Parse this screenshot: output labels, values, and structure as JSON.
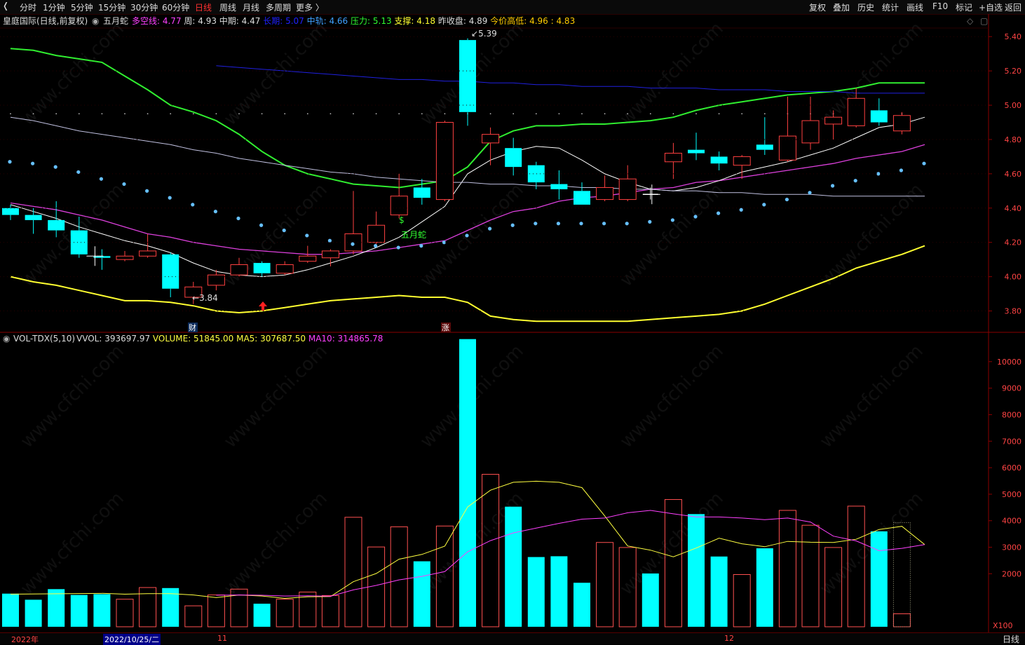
{
  "toolbar": {
    "collapse_icon": "chevron-left-icon",
    "periods": [
      {
        "label": "分时"
      },
      {
        "label": "1分钟"
      },
      {
        "label": "5分钟"
      },
      {
        "label": "15分钟"
      },
      {
        "label": "30分钟"
      },
      {
        "label": "60分钟"
      },
      {
        "label": "日线",
        "active": true
      },
      {
        "label": "周线"
      },
      {
        "label": "月线"
      },
      {
        "label": "多周期"
      },
      {
        "label": "更多 〉"
      }
    ],
    "right_buttons": [
      "复权",
      "叠加",
      "历史",
      "统计",
      "画线",
      "F10",
      "标记",
      "+自选",
      "返回"
    ]
  },
  "main_info": {
    "title": "皇庭国际(日线,前复权)",
    "indicator": "五月蛇",
    "items": [
      {
        "label": "多空线:",
        "value": "4.77",
        "color": "#ff40ff"
      },
      {
        "label": "周:",
        "value": "4.93",
        "color": "#dddddd"
      },
      {
        "label": "中期:",
        "value": "4.47",
        "color": "#dddddd"
      },
      {
        "label": "长期:",
        "value": "5.07",
        "color": "#2020ff"
      },
      {
        "label": "中轨:",
        "value": "4.66",
        "color": "#40a0ff"
      },
      {
        "label": "压力:",
        "value": "5.13",
        "color": "#30ff30"
      },
      {
        "label": "支撑:",
        "value": "4.18",
        "color": "#ffff30"
      },
      {
        "label": "昨收盘:",
        "value": "4.89",
        "color": "#dddddd"
      },
      {
        "label": "今价高低:",
        "value": "4.96 : 4.83",
        "color": "#ffcc00"
      }
    ]
  },
  "vol_info": {
    "name": "VOL-TDX(5,10)",
    "items": [
      {
        "label": "VVOL:",
        "value": "393697.97",
        "color": "#dddddd"
      },
      {
        "label": "VOLUME:",
        "value": "51845.00",
        "color": "#ffff40"
      },
      {
        "label": "MA5:",
        "value": "307687.50",
        "color": "#ffff40"
      },
      {
        "label": "MA10:",
        "value": "314865.78",
        "color": "#ff40ff"
      }
    ]
  },
  "annotations": {
    "high_label": "5.39",
    "low_label": "3.84",
    "signal_label": "五月蛇",
    "dollar_sign": "$",
    "event_cai": "财",
    "event_zhang": "涨",
    "vol_multiplier": "X100"
  },
  "bottom": {
    "dates": [
      {
        "label": "2022年"
      },
      {
        "label": "2022/10/25/二",
        "selected": true
      },
      {
        "label": "11"
      },
      {
        "label": "12"
      }
    ],
    "period_label": "日线"
  },
  "chart_data": [
    {
      "type": "candlestick",
      "ylim": [
        3.7,
        5.45
      ],
      "y_ticks": [
        3.8,
        4.0,
        4.2,
        4.4,
        4.6,
        4.8,
        5.0,
        5.2,
        5.4
      ],
      "candles": [
        {
          "o": 4.4,
          "c": 4.36,
          "h": 4.42,
          "l": 4.33
        },
        {
          "o": 4.36,
          "c": 4.33,
          "h": 4.4,
          "l": 4.25
        },
        {
          "o": 4.33,
          "c": 4.27,
          "h": 4.44,
          "l": 4.23
        },
        {
          "o": 4.27,
          "c": 4.13,
          "h": 4.35,
          "l": 4.11
        },
        {
          "o": 4.12,
          "c": 4.11,
          "h": 4.16,
          "l": 4.04
        },
        {
          "o": 4.1,
          "c": 4.12,
          "h": 4.15,
          "l": 4.09
        },
        {
          "o": 4.12,
          "c": 4.15,
          "h": 4.25,
          "l": 4.11
        },
        {
          "o": 4.13,
          "c": 3.93,
          "h": 4.14,
          "l": 3.88
        },
        {
          "o": 3.88,
          "c": 3.94,
          "h": 3.97,
          "l": 3.84
        },
        {
          "o": 3.95,
          "c": 4.01,
          "h": 4.04,
          "l": 3.92
        },
        {
          "o": 4.01,
          "c": 4.07,
          "h": 4.11,
          "l": 4.0
        },
        {
          "o": 4.08,
          "c": 4.02,
          "h": 4.09,
          "l": 4.0
        },
        {
          "o": 4.02,
          "c": 4.07,
          "h": 4.09,
          "l": 4.01
        },
        {
          "o": 4.09,
          "c": 4.12,
          "h": 4.18,
          "l": 4.08
        },
        {
          "o": 4.11,
          "c": 4.15,
          "h": 4.16,
          "l": 4.06
        },
        {
          "o": 4.15,
          "c": 4.25,
          "h": 4.5,
          "l": 4.13
        },
        {
          "o": 4.2,
          "c": 4.3,
          "h": 4.38,
          "l": 4.19
        },
        {
          "o": 4.36,
          "c": 4.47,
          "h": 4.6,
          "l": 4.34
        },
        {
          "o": 4.52,
          "c": 4.46,
          "h": 4.57,
          "l": 4.42
        },
        {
          "o": 4.45,
          "c": 4.9,
          "h": 4.91,
          "l": 4.44
        },
        {
          "o": 5.38,
          "c": 4.96,
          "h": 5.39,
          "l": 4.88
        },
        {
          "o": 4.78,
          "c": 4.83,
          "h": 4.87,
          "l": 4.65
        },
        {
          "o": 4.75,
          "c": 4.64,
          "h": 4.81,
          "l": 4.59
        },
        {
          "o": 4.65,
          "c": 4.55,
          "h": 4.67,
          "l": 4.51
        },
        {
          "o": 4.54,
          "c": 4.51,
          "h": 4.62,
          "l": 4.45
        },
        {
          "o": 4.5,
          "c": 4.42,
          "h": 4.55,
          "l": 4.42
        },
        {
          "o": 4.45,
          "c": 4.52,
          "h": 4.59,
          "l": 4.44
        },
        {
          "o": 4.45,
          "c": 4.57,
          "h": 4.65,
          "l": 4.44
        },
        {
          "o": 4.48,
          "c": 4.48,
          "h": 4.52,
          "l": 4.45
        },
        {
          "o": 4.67,
          "c": 4.72,
          "h": 4.78,
          "l": 4.57
        },
        {
          "o": 4.74,
          "c": 4.72,
          "h": 4.84,
          "l": 4.68
        },
        {
          "o": 4.7,
          "c": 4.66,
          "h": 4.73,
          "l": 4.62
        },
        {
          "o": 4.65,
          "c": 4.7,
          "h": 4.71,
          "l": 4.57
        },
        {
          "o": 4.77,
          "c": 4.74,
          "h": 4.93,
          "l": 4.71
        },
        {
          "o": 4.68,
          "c": 4.82,
          "h": 5.05,
          "l": 4.67
        },
        {
          "o": 4.78,
          "c": 4.91,
          "h": 5.05,
          "l": 4.74
        },
        {
          "o": 4.89,
          "c": 4.93,
          "h": 4.97,
          "l": 4.8
        },
        {
          "o": 4.88,
          "c": 5.04,
          "h": 5.1,
          "l": 4.87
        },
        {
          "o": 4.97,
          "c": 4.9,
          "h": 5.04,
          "l": 4.88
        },
        {
          "o": 4.85,
          "c": 4.94,
          "h": 4.96,
          "l": 4.83
        }
      ],
      "lines": {
        "压力": [
          5.33,
          5.32,
          5.29,
          5.27,
          5.25,
          5.17,
          5.09,
          5.0,
          4.96,
          4.91,
          4.83,
          4.73,
          4.65,
          4.6,
          4.57,
          4.54,
          4.53,
          4.52,
          4.54,
          4.56,
          4.64,
          4.79,
          4.85,
          4.88,
          4.88,
          4.89,
          4.89,
          4.9,
          4.91,
          4.93,
          4.97,
          5.0,
          5.02,
          5.04,
          5.06,
          5.07,
          5.08,
          5.1,
          5.13,
          5.13,
          5.13
        ],
        "支撑": [
          4.0,
          3.97,
          3.95,
          3.92,
          3.89,
          3.86,
          3.86,
          3.85,
          3.83,
          3.8,
          3.79,
          3.8,
          3.82,
          3.84,
          3.86,
          3.87,
          3.88,
          3.89,
          3.88,
          3.88,
          3.85,
          3.77,
          3.75,
          3.74,
          3.74,
          3.74,
          3.74,
          3.74,
          3.75,
          3.76,
          3.77,
          3.78,
          3.8,
          3.84,
          3.89,
          3.94,
          3.99,
          4.05,
          4.09,
          4.13,
          4.18
        ],
        "多空线": [
          4.43,
          4.41,
          4.39,
          4.36,
          4.33,
          4.29,
          4.25,
          4.23,
          4.2,
          4.18,
          4.16,
          4.15,
          4.14,
          4.13,
          4.13,
          4.14,
          4.15,
          4.17,
          4.19,
          4.21,
          4.27,
          4.33,
          4.38,
          4.4,
          4.44,
          4.46,
          4.47,
          4.49,
          4.51,
          4.52,
          4.55,
          4.56,
          4.58,
          4.6,
          4.62,
          4.64,
          4.66,
          4.69,
          4.71,
          4.73,
          4.77
        ],
        "周": [
          4.42,
          4.38,
          4.34,
          4.29,
          4.25,
          4.21,
          4.18,
          4.14,
          4.08,
          4.03,
          4.01,
          4.0,
          4.01,
          4.04,
          4.08,
          4.12,
          4.17,
          4.23,
          4.32,
          4.41,
          4.6,
          4.68,
          4.73,
          4.76,
          4.75,
          4.68,
          4.6,
          4.55,
          4.51,
          4.5,
          4.52,
          4.56,
          4.61,
          4.64,
          4.67,
          4.71,
          4.75,
          4.81,
          4.87,
          4.89,
          4.93
        ],
        "中期": [
          4.93,
          4.91,
          4.88,
          4.85,
          4.83,
          4.81,
          4.79,
          4.77,
          4.74,
          4.72,
          4.69,
          4.67,
          4.65,
          4.63,
          4.61,
          4.6,
          4.58,
          4.57,
          4.56,
          4.55,
          4.55,
          4.54,
          4.54,
          4.53,
          4.53,
          4.52,
          4.52,
          4.51,
          4.51,
          4.5,
          4.5,
          4.49,
          4.49,
          4.48,
          4.48,
          4.48,
          4.47,
          4.47,
          4.47,
          4.47,
          4.47
        ],
        "长期": [
          null,
          null,
          null,
          null,
          null,
          null,
          null,
          null,
          null,
          5.23,
          5.22,
          5.21,
          5.2,
          5.19,
          5.18,
          5.17,
          5.16,
          5.15,
          5.15,
          5.14,
          5.14,
          5.13,
          5.13,
          5.12,
          5.12,
          5.11,
          5.11,
          5.11,
          5.1,
          5.1,
          5.1,
          5.09,
          5.09,
          5.09,
          5.08,
          5.08,
          5.08,
          5.07,
          5.07,
          5.07,
          5.07
        ],
        "中轨": [
          4.67,
          4.66,
          4.64,
          4.61,
          4.57,
          4.54,
          4.5,
          4.46,
          4.42,
          4.38,
          4.34,
          4.3,
          4.27,
          4.24,
          4.21,
          4.19,
          4.18,
          4.17,
          4.18,
          4.2,
          4.24,
          4.28,
          4.3,
          4.31,
          4.31,
          4.31,
          4.31,
          4.31,
          4.32,
          4.33,
          4.35,
          4.37,
          4.39,
          4.42,
          4.45,
          4.49,
          4.53,
          4.56,
          4.6,
          4.62,
          4.66
        ]
      },
      "dots_row": 4.95
    },
    {
      "type": "bar",
      "ylim": [
        0,
        11000
      ],
      "y_ticks": [
        2000,
        3000,
        4000,
        5000,
        6000,
        7000,
        8000,
        9000,
        10000
      ],
      "values": [
        1250,
        1020,
        1420,
        1200,
        1230,
        1040,
        1480,
        1460,
        790,
        1200,
        1420,
        870,
        1040,
        1310,
        1180,
        4130,
        3010,
        3770,
        2470,
        3800,
        10850,
        5750,
        4530,
        2630,
        2660,
        1660,
        3180,
        2990,
        2010,
        4800,
        4250,
        2650,
        1970,
        2960,
        4390,
        3830,
        2990,
        4550,
        3600,
        490
      ],
      "up": [
        false,
        false,
        false,
        false,
        false,
        true,
        true,
        false,
        true,
        true,
        true,
        false,
        true,
        true,
        true,
        true,
        true,
        true,
        false,
        true,
        false,
        true,
        false,
        false,
        false,
        false,
        true,
        true,
        false,
        true,
        false,
        false,
        true,
        false,
        true,
        true,
        true,
        true,
        false,
        true
      ],
      "ma5": [
        null,
        null,
        null,
        null,
        1260,
        1230,
        1250,
        1250,
        1200,
        1100,
        1200,
        1160,
        1070,
        1130,
        1140,
        1700,
        2010,
        2550,
        2730,
        3040,
        4520,
        5150,
        5450,
        5490,
        5450,
        5250,
        4180,
        3050,
        2890,
        2640,
        2970,
        3340,
        3130,
        3020,
        3220,
        3190,
        3180,
        3300,
        3670,
        3790,
        3100
      ],
      "ma10": [
        null,
        null,
        null,
        null,
        null,
        null,
        null,
        null,
        null,
        1190,
        1200,
        1190,
        1160,
        1170,
        1150,
        1390,
        1560,
        1770,
        1900,
        2080,
        2830,
        3250,
        3540,
        3720,
        3900,
        4060,
        4100,
        4300,
        4390,
        4260,
        4140,
        4140,
        4100,
        4040,
        4100,
        3950,
        3420,
        3240,
        2870,
        2960,
        3100
      ]
    }
  ]
}
